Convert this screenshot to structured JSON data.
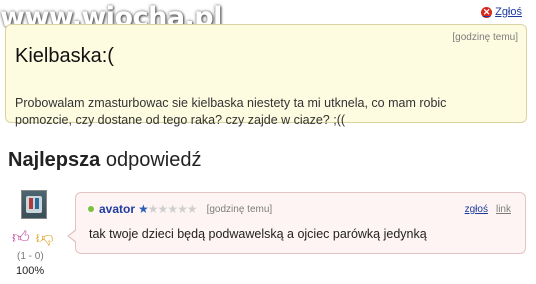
{
  "watermark": "www.wiocha.pl",
  "question": {
    "report_label": "Zgłoś",
    "title": "Kielbaska:(",
    "time": "[godzinę temu]",
    "body_lines": [
      "Probowalam zmasturbowac sie kielbaska niestety ta mi utknela, co mam robic",
      "pomozcie, czy dostane od tego raka? czy zajde w ciaze? ;(("
    ]
  },
  "best_answer": {
    "heading_bold": "Najlepsza",
    "heading_rest": "odpowiedź",
    "user": "avator",
    "stars_filled": 1,
    "stars_total": 10,
    "time": "[godzinę temu]",
    "report_label": "zgłoś",
    "link_label": "link",
    "text": "tak twoje dzieci będą podwawelską a ojciec parówką jedynką",
    "votes": "(1 - 0)",
    "percent": "100%",
    "icons": [
      "thumbs-up-icon",
      "thumbs-down-icon",
      "online-dot-icon",
      "star-icon"
    ]
  },
  "colors": {
    "question_bg": "#fdfbe0",
    "answer_bg": "#fff4f4",
    "link": "#1a3a9a",
    "username": "#1f3da0"
  }
}
